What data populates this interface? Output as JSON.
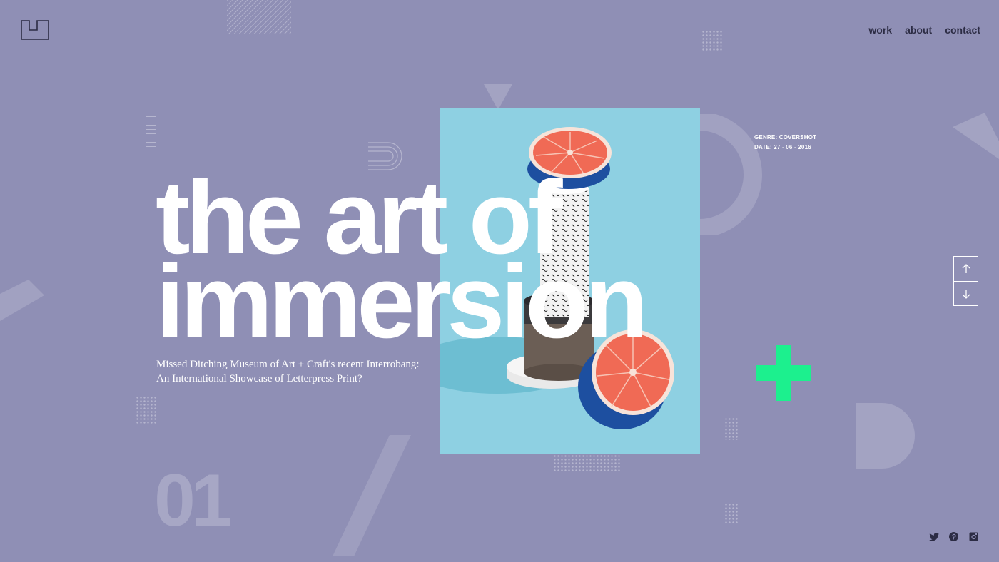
{
  "nav": {
    "items": [
      "work",
      "about",
      "contact"
    ]
  },
  "hero": {
    "line1": "the art of",
    "line2": "immersion",
    "subtitle_line1": "Missed Ditching Museum of Art + Craft's recent Interrobang:",
    "subtitle_line2": "An International Showcase of Letterpress Print?",
    "slide_number": "01"
  },
  "meta": {
    "genre": "GENRE: COVERSHOT",
    "date": "DATE: 27 - 06 - 2016"
  },
  "icons": {
    "logo": "logo-mark",
    "pager_up": "arrow-up-icon",
    "pager_down": "arrow-down-icon",
    "social": [
      "twitter-icon",
      "pinterest-icon",
      "instagram-icon"
    ],
    "accent": "plus-icon"
  },
  "colors": {
    "background": "#8f8fb5",
    "accent": "#1cf08e",
    "nav_text": "#2c2c44",
    "photo_background": "#8ed0e2",
    "grapefruit": "#f06a55"
  }
}
